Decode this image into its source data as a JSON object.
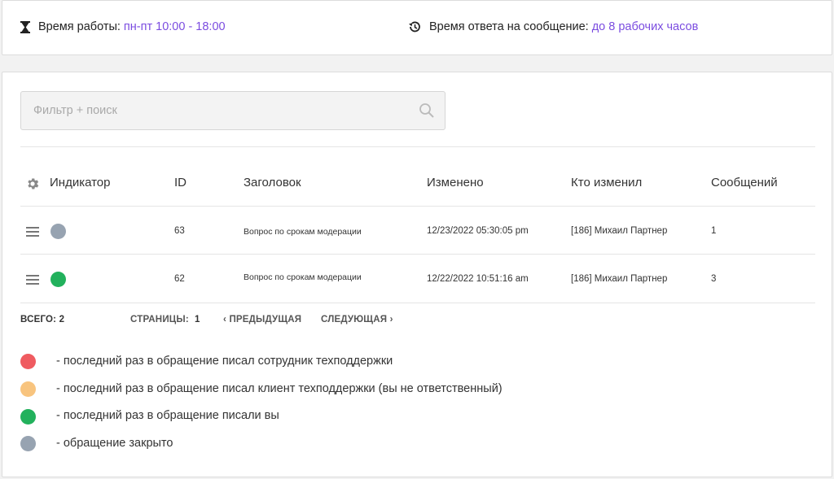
{
  "header": {
    "work_hours_label": "Время работы:",
    "work_hours_value": "пн-пт 10:00 - 18:00",
    "reply_time_label": "Время ответа на сообщение:",
    "reply_time_value": "до 8 рабочих часов"
  },
  "search": {
    "placeholder": "Фильтр + поиск"
  },
  "table": {
    "columns": [
      "Индикатор",
      "ID",
      "Заголовок",
      "Изменено",
      "Кто изменил",
      "Сообщений"
    ],
    "rows": [
      {
        "indicator": "closed",
        "id": "63",
        "title": "Вопрос по срокам модерации",
        "modified": "12/23/2022 05:30:05 pm",
        "modified_by": "[186] Михаил Партнер",
        "messages": "1"
      },
      {
        "indicator": "you",
        "id": "62",
        "title": "Вопрос по срокам модерации",
        "modified": "12/22/2022 10:51:16 am",
        "modified_by": "[186] Михаил Партнер",
        "messages": "3"
      }
    ]
  },
  "pagination": {
    "total_label": "ВСЕГО: 2",
    "pages_label": "СТРАНИЦЫ:",
    "current_page": "1",
    "prev_label": "ПРЕДЫДУЩАЯ",
    "next_label": "СЛЕДУЮЩАЯ"
  },
  "legend": [
    {
      "color": "#ef5b60",
      "text": "- последний раз в обращение писал сотрудник техподдержки"
    },
    {
      "color": "#f8c47e",
      "text": "- последний раз в обращение писал клиент техподдержки (вы не ответственный)"
    },
    {
      "color": "#22b15c",
      "text": "- последний раз в обращение писали вы"
    },
    {
      "color": "#97a3b1",
      "text": "- обращение закрыто"
    }
  ],
  "colors": {
    "accent": "#7b4ce0",
    "indicator_closed": "#97a3b1",
    "indicator_you": "#22b15c"
  },
  "icons": [
    "hourglass-icon",
    "history-icon",
    "search-icon",
    "gear-icon",
    "menu-icon",
    "chevron-left-icon",
    "chevron-right-icon"
  ]
}
